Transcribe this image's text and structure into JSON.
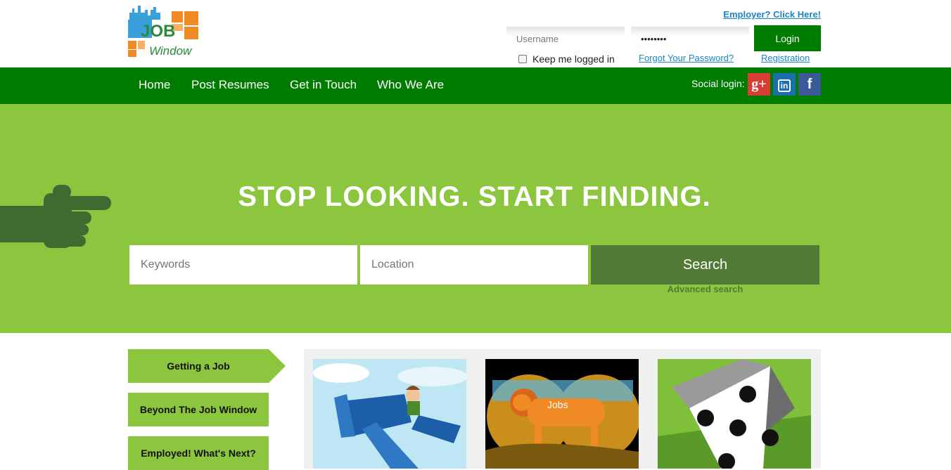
{
  "header": {
    "logo_text_1": "JOB",
    "logo_text_2": "Window",
    "employer_link": "Employer? Click Here!",
    "username_placeholder": "Username",
    "password_value": "••••••••",
    "login_label": "Login",
    "keep_logged_in": "Keep me logged in",
    "forgot_password": "Forgot Your Password?",
    "registration": "Registration"
  },
  "nav": {
    "items": [
      "Home",
      "Post Resumes",
      "Get in Touch",
      "Who We Are"
    ],
    "social_label": "Social login:",
    "social": [
      {
        "name": "google-plus",
        "glyph": "g+",
        "color": "#d73d32"
      },
      {
        "name": "linkedin",
        "glyph": "in",
        "color": "#1a6faf"
      },
      {
        "name": "facebook",
        "glyph": "f",
        "color": "#3b5998"
      }
    ]
  },
  "hero": {
    "tagline": "STOP LOOKING. START FINDING.",
    "keywords_placeholder": "Keywords",
    "location_placeholder": "Location",
    "search_label": "Search",
    "advanced_label": "Advanced search"
  },
  "sidebar": {
    "tabs": [
      "Getting a Job",
      "Beyond The Job Window",
      "Employed! What's Next?"
    ]
  },
  "cards": {
    "lion_text": "Jobs"
  },
  "colors": {
    "nav_green": "#007c00",
    "hero_green": "#8cc63f",
    "search_btn": "#527a37",
    "link_blue": "#1a84c9"
  }
}
